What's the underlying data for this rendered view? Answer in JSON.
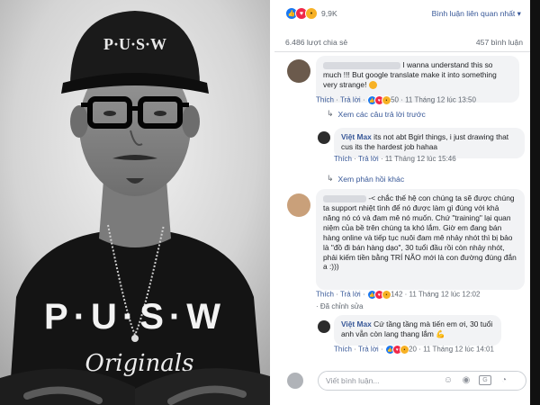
{
  "photo": {
    "shirt_text": "P·U·S·W",
    "shirt_script": "Originals",
    "cap_text": "P·U·S·W"
  },
  "post": {
    "reaction_count": "9,9K",
    "sort_label": "Bình luận liên quan nhất ▾",
    "shares": "6.486 lượt chia sẻ",
    "comments_count": "457 bình luận"
  },
  "comments": [
    {
      "text": "I wanna understand this so much !!! But google translate make it into something very strange! ",
      "actions": {
        "like": "Thích",
        "reply": "Trả lời"
      },
      "reactions": "50",
      "time": "11 Tháng 12 lúc 13:50"
    },
    {
      "view_more": "Xem các câu trả lời trước"
    },
    {
      "name": "Việt Max",
      "text": "its not abt Bgirl things, i just drawing that cus its the hardest job hahaa",
      "actions": {
        "like": "Thích",
        "reply": "Trả lời"
      },
      "time": "11 Tháng 12 lúc 15:46"
    },
    {
      "view_more": "Xem phản hồi khác"
    },
    {
      "text": "-< chắc thế hệ con chúng ta sẽ được chúng ta support nhiệt tình để nó được làm gì đúng với khả năng nó có và đam mê nó muốn. Chứ \"training\" lại quan niệm của bề trên chúng ta khó lắm. Giờ em đang bán hàng online và tiếp tục nuôi đam mê nhảy nhót thì bị bảo là \"đồ đi bán hàng dạo\", 30 tuổi đầu rồi còn nhảy nhót, phải kiếm tiền bằng TRÍ NÃO mới là con đường đúng đắn a :)))",
      "actions": {
        "like": "Thích",
        "reply": "Trả lời"
      },
      "reactions": "142",
      "time": "11 Tháng 12 lúc 12:02",
      "edited": "Đã chỉnh sửa"
    },
    {
      "name": "Việt Max",
      "text": "Cứ tầng tầng mà tiến em ơi, 30 tuổi anh vẫn còn lang thang lắm ",
      "actions": {
        "like": "Thích",
        "reply": "Trả lời"
      },
      "reactions": "20",
      "time": "11 Tháng 12 lúc 14:01"
    }
  ],
  "composer": {
    "placeholder": "Viết bình luận..."
  },
  "colors": {
    "link": "#385898",
    "bubble": "#f2f3f5",
    "like": "#1877f2",
    "love": "#f02849",
    "haha": "#f7b125"
  }
}
